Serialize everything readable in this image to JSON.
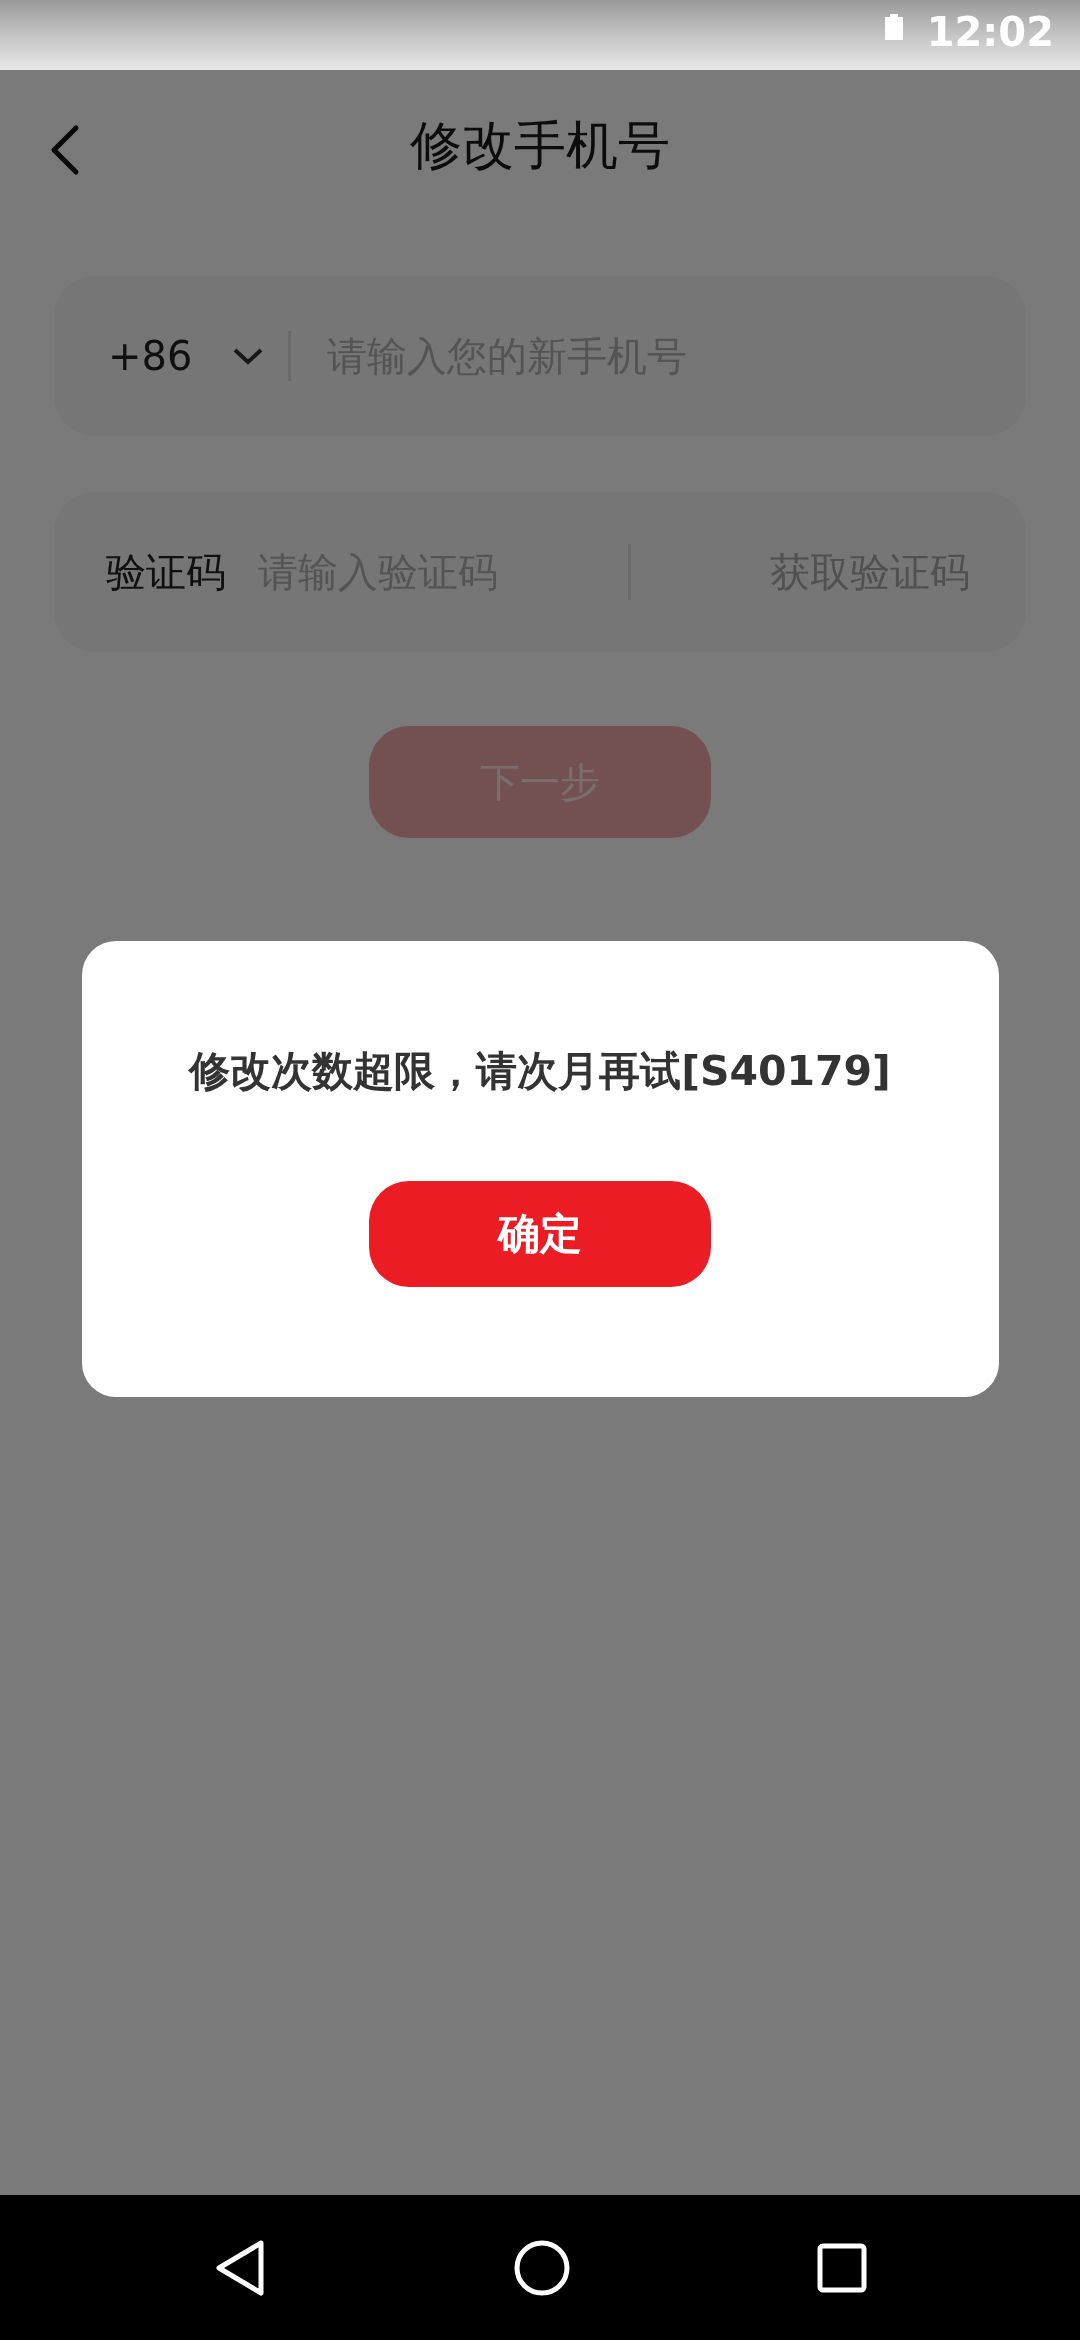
{
  "status_bar": {
    "time": "12:02"
  },
  "header": {
    "title": "修改手机号"
  },
  "phone_field": {
    "country_code": "+86",
    "placeholder": "请输入您的新手机号"
  },
  "code_field": {
    "label": "验证码",
    "placeholder": "请输入验证码",
    "action": "获取验证码"
  },
  "next_button": {
    "label": "下一步",
    "disabled": true
  },
  "dialog": {
    "message": "修改次数超限，请次月再试[S40179]",
    "button": "确定"
  }
}
